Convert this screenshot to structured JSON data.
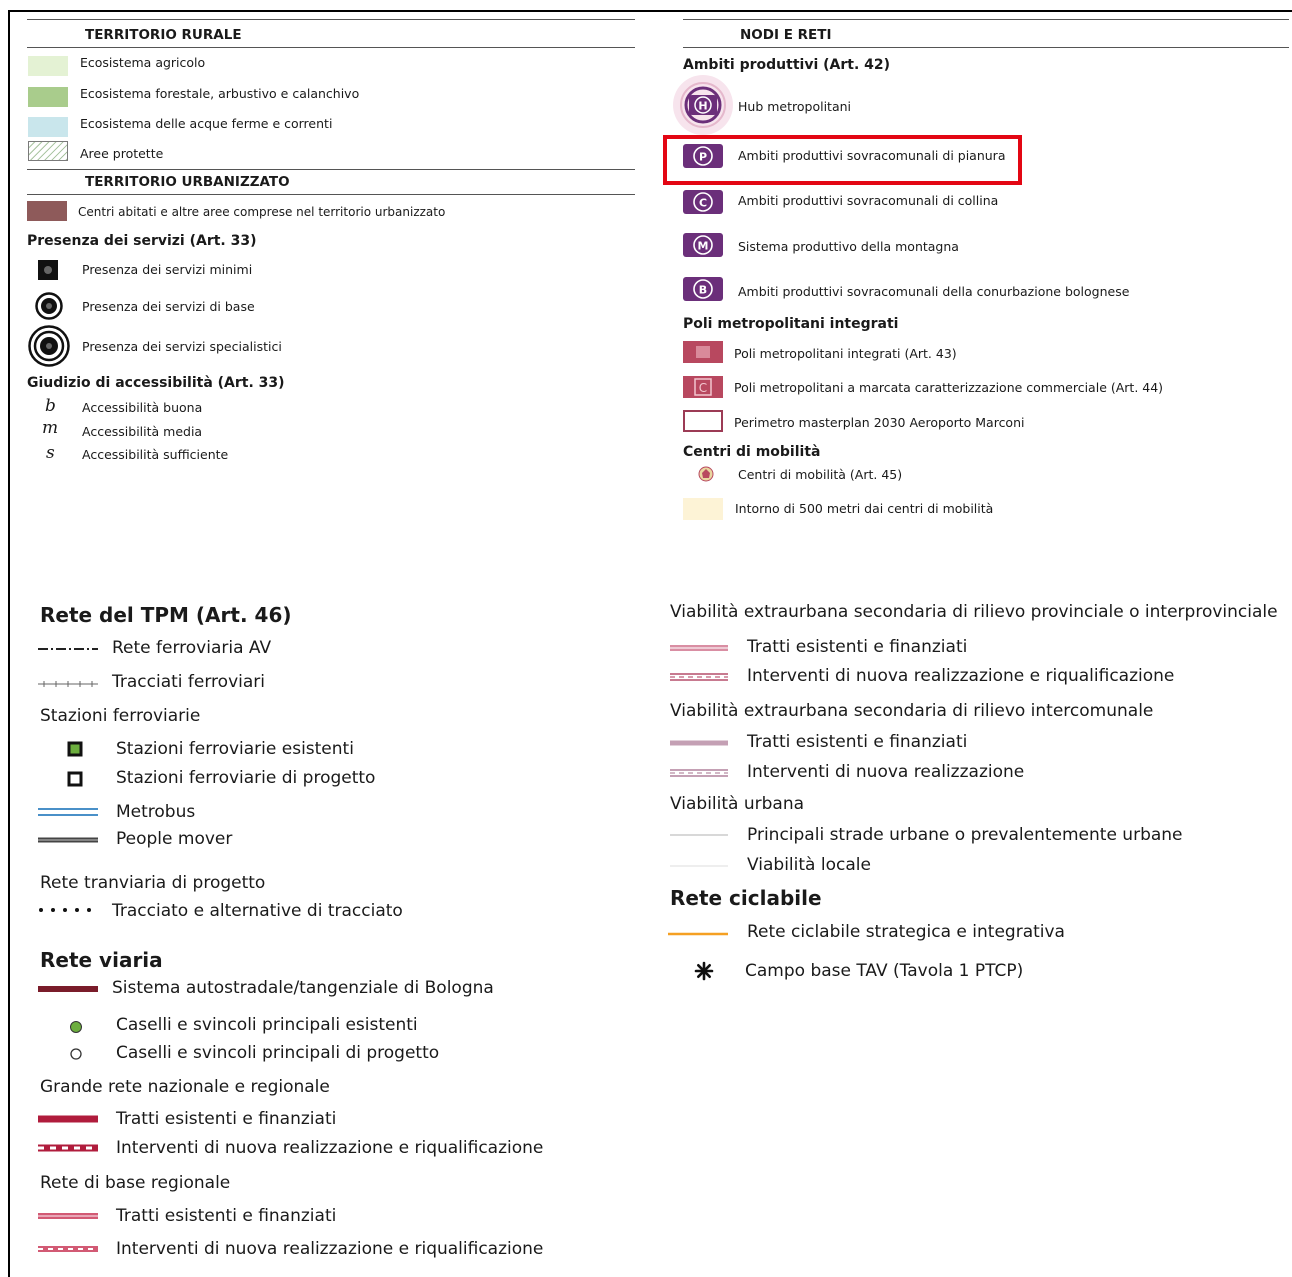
{
  "left_panel": {
    "rural_heading": "TERRITORIO RURALE",
    "rural_items": [
      {
        "label": "Ecosistema agricolo",
        "color": "#e4f2d4"
      },
      {
        "label": "Ecosistema forestale, arbustivo e calanchivo",
        "color": "#a9cc8c"
      },
      {
        "label": "Ecosistema delle acque ferme e correnti",
        "color": "#c9e6ec"
      },
      {
        "label": "Aree protette",
        "color": "#7fa873"
      }
    ],
    "urban_heading": "TERRITORIO URBANIZZATO",
    "urban_item": {
      "label": "Centri abitati e altre aree comprese nel territorio urbanizzato",
      "color": "#8e5a5a"
    },
    "services_heading": "Presenza dei servizi (Art. 33)",
    "services": [
      {
        "label": "Presenza dei servizi minimi",
        "icon": "square-dot-icon"
      },
      {
        "label": "Presenza dei servizi di base",
        "icon": "ring-dot-icon"
      },
      {
        "label": "Presenza dei servizi specialistici",
        "icon": "double-ring-dot-icon"
      }
    ],
    "access_heading": "Giudizio di accessibilità (Art. 33)",
    "access": [
      {
        "symbol": "b",
        "label": "Accessibilità buona"
      },
      {
        "symbol": "m",
        "label": "Accessibilità media"
      },
      {
        "symbol": "s",
        "label": "Accessibilità sufficiente"
      }
    ]
  },
  "right_panel": {
    "nodes_heading": "NODI E RETI",
    "productive_heading": "Ambiti produttivi (Art. 42)",
    "productive": [
      {
        "letter": "H",
        "label": "Hub metropolitani"
      },
      {
        "letter": "P",
        "label": "Ambiti produttivi sovracomunali di pianura"
      },
      {
        "letter": "C",
        "label": "Ambiti produttivi sovracomunali di collina"
      },
      {
        "letter": "M",
        "label": "Sistema produttivo della montagna"
      },
      {
        "letter": "B",
        "label": "Ambiti produttivi sovracomunali della conurbazione bolognese"
      }
    ],
    "productive_color": "#6b2f7a",
    "highlight_color": "#e30613",
    "poles_heading": "Poli metropolitani integrati",
    "poles": [
      {
        "label": "Poli metropolitani integrati (Art. 43)",
        "color": "#b8485f"
      },
      {
        "label": "Poli metropolitani a marcata caratterizzazione commerciale (Art. 44)",
        "color": "#b8485f"
      },
      {
        "label": "Perimetro masterplan 2030 Aeroporto Marconi",
        "color": "#9c3b55"
      }
    ],
    "mobility_heading": "Centri di mobilità",
    "mobility": [
      {
        "label": "Centri di mobilità (Art. 45)",
        "icon": "mobility-center-icon"
      },
      {
        "label": "Intorno di 500 metri dai centri di mobilità",
        "color": "#fdf3d6"
      }
    ]
  },
  "bottom_left": {
    "tpm_heading": "Rete del TPM (Art. 46)",
    "tpm": [
      {
        "label": "Rete ferroviaria AV"
      },
      {
        "label": "Tracciati ferroviari"
      }
    ],
    "stations_heading": "Stazioni ferroviarie",
    "stations": [
      {
        "label": "Stazioni ferroviarie esistenti"
      },
      {
        "label": "Stazioni ferroviarie di progetto"
      },
      {
        "label": "Metrobus"
      },
      {
        "label": "People mover"
      }
    ],
    "tram_heading": "Rete tranviaria di progetto",
    "tram_item": "Tracciato e alternative di tracciato",
    "road_heading": "Rete viaria",
    "road_item": "Sistema autostradale/tangenziale di Bologna",
    "tolls": [
      {
        "label": "Caselli e svincoli principali esistenti",
        "color": "#6cae3e"
      },
      {
        "label": "Caselli e svincoli principali di progetto",
        "color": "#ffffff"
      }
    ],
    "national_heading": "Grande rete nazionale e regionale",
    "national": [
      {
        "label": "Tratti esistenti e finanziati",
        "color": "#b01c3c"
      },
      {
        "label": "Interventi di nuova realizzazione e riqualificazione",
        "color": "#b01c3c"
      }
    ],
    "regional_heading": "Rete di base regionale",
    "regional": [
      {
        "label": "Tratti esistenti e finanziati",
        "color": "#d25a74"
      },
      {
        "label": "Interventi di nuova realizzazione e riqualificazione",
        "color": "#d25a74"
      }
    ]
  },
  "bottom_right": {
    "prov_heading": "Viabilità extraurbana secondaria di rilievo provinciale o interprovinciale",
    "prov": [
      {
        "label": "Tratti esistenti e finanziati",
        "color": "#d98ea3"
      },
      {
        "label": "Interventi di nuova realizzazione e riqualificazione",
        "color": "#c87a90"
      }
    ],
    "inter_heading": "Viabilità extraurbana secondaria di rilievo intercomunale",
    "inter": [
      {
        "label": "Tratti esistenti e finanziati",
        "color": "#c4a0b4"
      },
      {
        "label": "Interventi di nuova realizzazione",
        "color": "#c4a0b4"
      }
    ],
    "urban_heading": "Viabilità urbana",
    "urban": [
      {
        "label": "Principali strade urbane o prevalentemente urbane",
        "color": "#d8d8d8"
      },
      {
        "label": "Viabilità locale",
        "color": "#eeeeee"
      }
    ],
    "cycle_heading": "Rete ciclabile",
    "cycle": [
      {
        "label": "Rete ciclabile strategica e integrativa",
        "color": "#f5a022"
      },
      {
        "label": "Campo base TAV (Tavola 1 PTCP)",
        "icon": "asterisk-icon"
      }
    ]
  }
}
